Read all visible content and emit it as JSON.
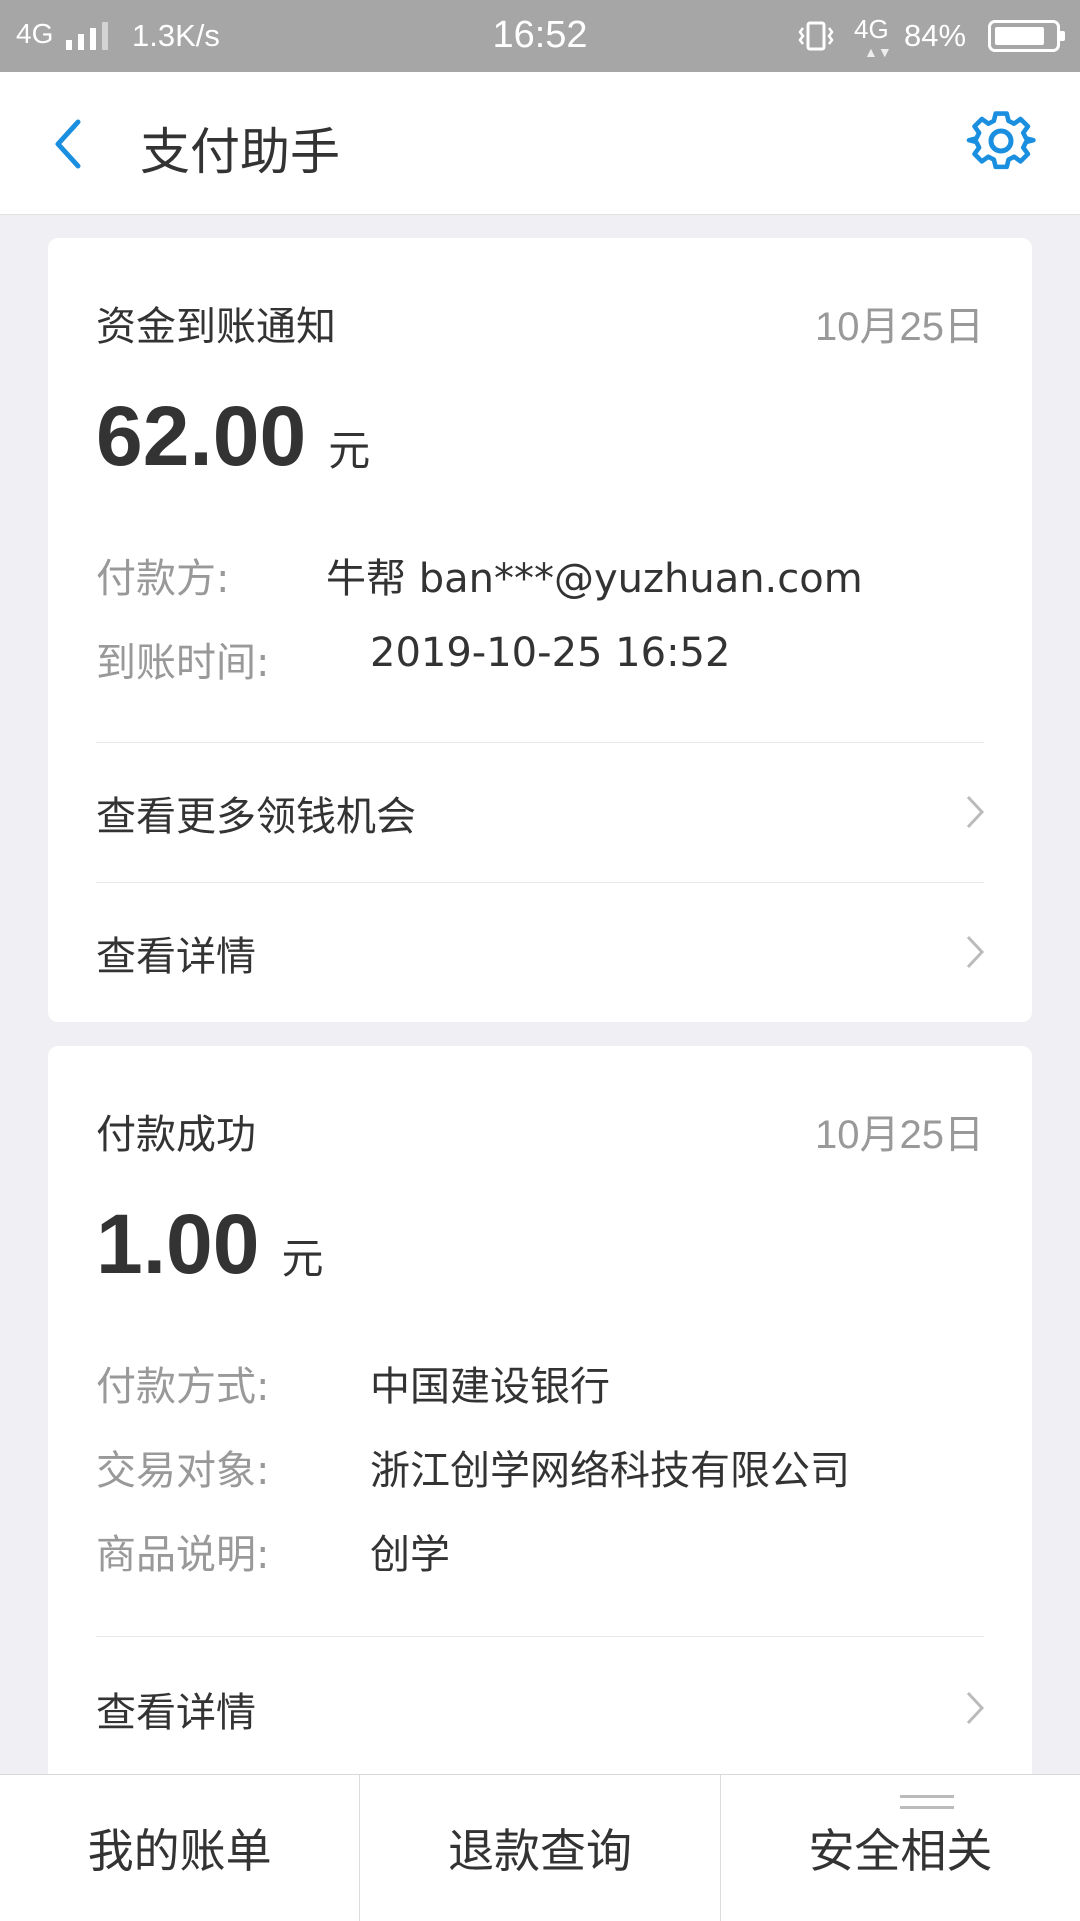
{
  "status_bar": {
    "network": "4G",
    "speed": "1.3K/s",
    "time": "16:52",
    "network2": "4G",
    "battery": "84%",
    "battery_level": 0.84
  },
  "header": {
    "title": "支付助手",
    "back_icon": "chevron-left-icon",
    "settings_icon": "gear-icon",
    "accent_color": "#1a8fe0"
  },
  "cards": [
    {
      "kind": "资金到账通知",
      "date": "10月25日",
      "amount": "62.00",
      "unit": "元",
      "fields": [
        {
          "label": "付款方:",
          "value": "牛帮 ban***@yuzhuan.com"
        },
        {
          "label": "到账时间:",
          "value": "2019-10-25 16:52"
        }
      ],
      "links": [
        "查看更多领钱机会",
        "查看详情"
      ]
    },
    {
      "kind": "付款成功",
      "date": "10月25日",
      "amount": "1.00",
      "unit": "元",
      "fields": [
        {
          "label": "付款方式:",
          "value": "中国建设银行"
        },
        {
          "label": "交易对象:",
          "value": "浙江创学网络科技有限公司"
        },
        {
          "label": "商品说明:",
          "value": "创学"
        }
      ],
      "links": [
        "查看详情"
      ]
    }
  ],
  "tabs": [
    "我的账单",
    "退款查询",
    "安全相关"
  ]
}
